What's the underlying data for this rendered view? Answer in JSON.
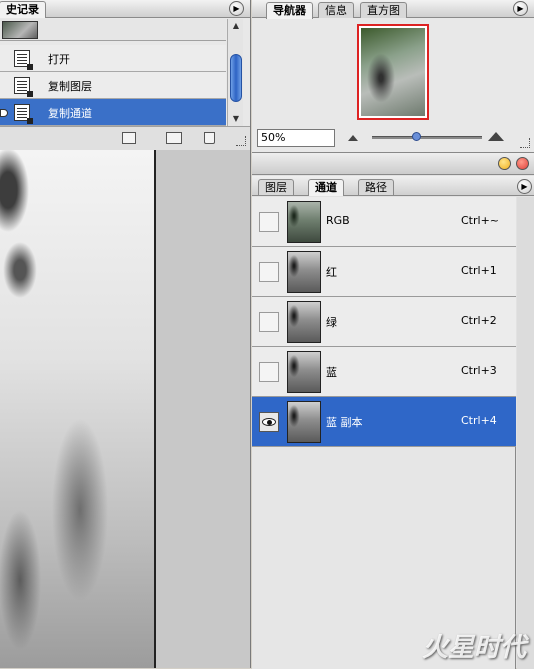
{
  "history": {
    "tab_label": "史记录",
    "items": [
      {
        "label": "打开",
        "selected": false
      },
      {
        "label": "复制图层",
        "selected": false
      },
      {
        "label": "复制通道",
        "selected": true
      }
    ]
  },
  "navigator": {
    "tabs": [
      "导航器",
      "信息",
      "直方图"
    ],
    "zoom": "50%"
  },
  "channels_panel": {
    "tabs": [
      "图层",
      "通道",
      "路径"
    ],
    "channels": [
      {
        "name": "RGB",
        "shortcut": "Ctrl+~",
        "visible": false,
        "selected": false
      },
      {
        "name": "红",
        "shortcut": "Ctrl+1",
        "visible": false,
        "selected": false
      },
      {
        "name": "绿",
        "shortcut": "Ctrl+2",
        "visible": false,
        "selected": false
      },
      {
        "name": "蓝",
        "shortcut": "Ctrl+3",
        "visible": false,
        "selected": false
      },
      {
        "name": "蓝 副本",
        "shortcut": "Ctrl+4",
        "visible": true,
        "selected": true
      }
    ]
  },
  "watermark": "火星时代",
  "colors": {
    "selection": "#2f67c8",
    "scroll_thumb": "#2d63c4",
    "close_button": "#e0403a",
    "minimize_button": "#f0b020"
  }
}
